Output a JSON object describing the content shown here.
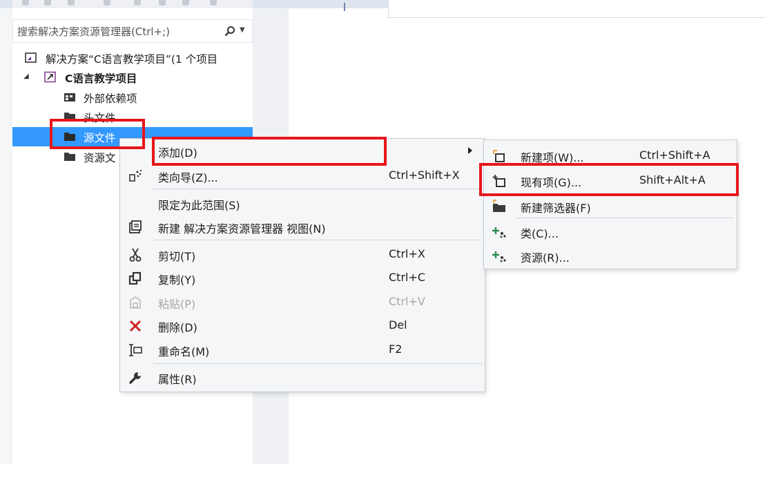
{
  "search": {
    "placeholder": "搜索解决方案资源管理器(Ctrl+;)"
  },
  "tree": {
    "solution_label": "解决方案“C语言教学项目”(1 个项目",
    "project_label": "C语言教学项目",
    "items": [
      {
        "label": "外部依赖项",
        "icon": "external-dependencies-icon"
      },
      {
        "label": "头文件",
        "icon": "folder-icon"
      },
      {
        "label": "源文件",
        "icon": "folder-icon",
        "selected": true
      },
      {
        "label": "资源文",
        "icon": "folder-icon"
      }
    ]
  },
  "context_menu": {
    "items": [
      {
        "label": "添加(D)",
        "shortcut": "",
        "icon": "",
        "has_submenu": true
      },
      {
        "label": "类向导(Z)...",
        "shortcut": "Ctrl+Shift+X",
        "icon": "class-wizard-icon"
      },
      {
        "label": "限定为此范围(S)",
        "shortcut": "",
        "icon": ""
      },
      {
        "label": "新建 解决方案资源管理器 视图(N)",
        "shortcut": "",
        "icon": "new-view-icon"
      },
      {
        "label": "剪切(T)",
        "shortcut": "Ctrl+X",
        "icon": "scissors-icon"
      },
      {
        "label": "复制(Y)",
        "shortcut": "Ctrl+C",
        "icon": "copy-icon"
      },
      {
        "label": "粘贴(P)",
        "shortcut": "Ctrl+V",
        "icon": "paste-icon",
        "disabled": true
      },
      {
        "label": "删除(D)",
        "shortcut": "Del",
        "icon": "delete-icon"
      },
      {
        "label": "重命名(M)",
        "shortcut": "F2",
        "icon": "rename-icon"
      },
      {
        "label": "属性(R)",
        "shortcut": "",
        "icon": "wrench-icon"
      }
    ]
  },
  "submenu": {
    "items": [
      {
        "label": "新建项(W)...",
        "shortcut": "Ctrl+Shift+A",
        "icon": "new-item-icon"
      },
      {
        "label": "现有项(G)...",
        "shortcut": "Shift+Alt+A",
        "icon": "existing-item-icon"
      },
      {
        "label": "新建筛选器(F)",
        "shortcut": "",
        "icon": "new-filter-icon"
      },
      {
        "label": "类(C)...",
        "shortcut": "",
        "icon": "class-icon"
      },
      {
        "label": "资源(R)...",
        "shortcut": "",
        "icon": "resource-icon"
      }
    ]
  },
  "colors": {
    "selection": "#3399ff",
    "highlight": "#e8161b",
    "delete_icon": "#d0201f"
  }
}
